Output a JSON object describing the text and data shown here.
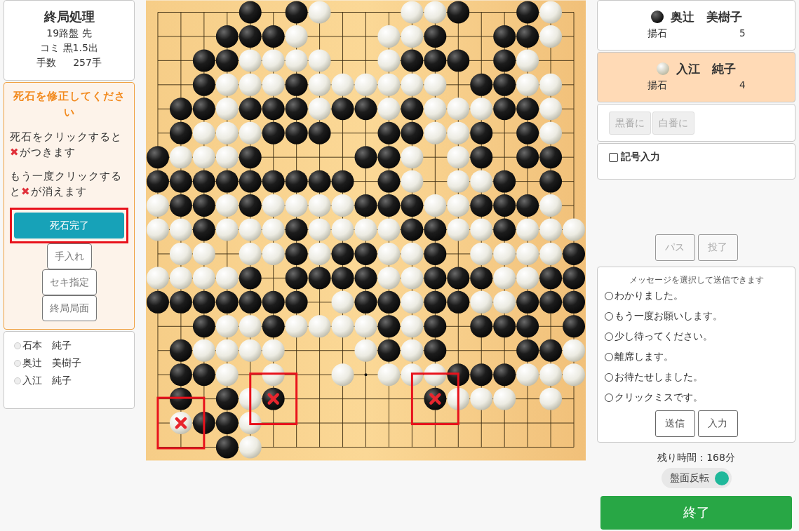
{
  "game_info": {
    "title": "終局処理",
    "lines": [
      "19路盤 先",
      "コミ 黒1.5出"
    ],
    "moves_label": "手数",
    "moves_value": "257手"
  },
  "dead_stone_panel": {
    "heading": "死石を修正してください",
    "instructions": [
      {
        "before": "死石をクリックすると",
        "mark": "✖",
        "after": "がつきます"
      },
      {
        "before": "もう一度クリックすると",
        "mark": "✖",
        "after": "が消えます"
      }
    ],
    "primary_button": {
      "label": "死石完了",
      "highlighted": true
    },
    "buttons": [
      "手入れ",
      "セキ指定",
      "終局局面"
    ]
  },
  "participants": [
    {
      "name": "石本　純子",
      "selected": false
    },
    {
      "name": "奥辻　美樹子",
      "selected": false
    },
    {
      "name": "入江　純子",
      "selected": false
    }
  ],
  "board": {
    "rows": [
      [
        {
          "kind": "empty"
        },
        {
          "kind": "empty"
        },
        {
          "kind": "empty"
        },
        {
          "kind": "empty"
        },
        {
          "kind": "black"
        },
        {
          "kind": "empty"
        },
        {
          "kind": "black"
        },
        {
          "kind": "white"
        },
        {
          "kind": "empty"
        },
        {
          "kind": "empty"
        },
        {
          "kind": "empty"
        },
        {
          "kind": "white"
        },
        {
          "kind": "white"
        },
        {
          "kind": "black"
        },
        {
          "kind": "empty"
        },
        {
          "kind": "empty"
        },
        {
          "kind": "black"
        },
        {
          "kind": "white"
        },
        {
          "kind": "empty"
        }
      ],
      [
        {
          "kind": "empty"
        },
        {
          "kind": "empty"
        },
        {
          "kind": "empty"
        },
        {
          "kind": "black"
        },
        {
          "kind": "black"
        },
        {
          "kind": "black"
        },
        {
          "kind": "white"
        },
        {
          "kind": "empty"
        },
        {
          "kind": "empty"
        },
        {
          "kind": "empty"
        },
        {
          "kind": "white"
        },
        {
          "kind": "white"
        },
        {
          "kind": "black"
        },
        {
          "kind": "empty"
        },
        {
          "kind": "empty"
        },
        {
          "kind": "black"
        },
        {
          "kind": "black"
        },
        {
          "kind": "white"
        },
        {
          "kind": "empty"
        }
      ],
      [
        {
          "kind": "empty"
        },
        {
          "kind": "empty"
        },
        {
          "kind": "black"
        },
        {
          "kind": "black"
        },
        {
          "kind": "white"
        },
        {
          "kind": "white"
        },
        {
          "kind": "white"
        },
        {
          "kind": "white"
        },
        {
          "kind": "empty"
        },
        {
          "kind": "empty"
        },
        {
          "kind": "white"
        },
        {
          "kind": "black"
        },
        {
          "kind": "black"
        },
        {
          "kind": "black"
        },
        {
          "kind": "empty"
        },
        {
          "kind": "black"
        },
        {
          "kind": "white"
        },
        {
          "kind": "empty"
        },
        {
          "kind": "empty"
        }
      ],
      [
        {
          "kind": "empty"
        },
        {
          "kind": "empty"
        },
        {
          "kind": "black"
        },
        {
          "kind": "white"
        },
        {
          "kind": "white"
        },
        {
          "kind": "white"
        },
        {
          "kind": "black"
        },
        {
          "kind": "white"
        },
        {
          "kind": "white"
        },
        {
          "kind": "white"
        },
        {
          "kind": "white"
        },
        {
          "kind": "white"
        },
        {
          "kind": "white"
        },
        {
          "kind": "empty"
        },
        {
          "kind": "black"
        },
        {
          "kind": "black"
        },
        {
          "kind": "white"
        },
        {
          "kind": "white"
        },
        {
          "kind": "empty"
        }
      ],
      [
        {
          "kind": "empty"
        },
        {
          "kind": "black"
        },
        {
          "kind": "black"
        },
        {
          "kind": "white"
        },
        {
          "kind": "black"
        },
        {
          "kind": "black"
        },
        {
          "kind": "black"
        },
        {
          "kind": "white"
        },
        {
          "kind": "black"
        },
        {
          "kind": "black"
        },
        {
          "kind": "white"
        },
        {
          "kind": "black"
        },
        {
          "kind": "white"
        },
        {
          "kind": "white"
        },
        {
          "kind": "white"
        },
        {
          "kind": "black"
        },
        {
          "kind": "black"
        },
        {
          "kind": "white"
        },
        {
          "kind": "empty"
        }
      ],
      [
        {
          "kind": "empty"
        },
        {
          "kind": "black"
        },
        {
          "kind": "white"
        },
        {
          "kind": "white"
        },
        {
          "kind": "white"
        },
        {
          "kind": "black"
        },
        {
          "kind": "black"
        },
        {
          "kind": "black"
        },
        {
          "kind": "empty"
        },
        {
          "kind": "empty"
        },
        {
          "kind": "black"
        },
        {
          "kind": "black"
        },
        {
          "kind": "white"
        },
        {
          "kind": "white"
        },
        {
          "kind": "black"
        },
        {
          "kind": "empty"
        },
        {
          "kind": "black"
        },
        {
          "kind": "white"
        },
        {
          "kind": "empty"
        }
      ],
      [
        {
          "kind": "black"
        },
        {
          "kind": "white"
        },
        {
          "kind": "white"
        },
        {
          "kind": "white"
        },
        {
          "kind": "black"
        },
        {
          "kind": "empty"
        },
        {
          "kind": "empty"
        },
        {
          "kind": "empty"
        },
        {
          "kind": "empty"
        },
        {
          "kind": "black"
        },
        {
          "kind": "black"
        },
        {
          "kind": "white"
        },
        {
          "kind": "empty"
        },
        {
          "kind": "white"
        },
        {
          "kind": "black"
        },
        {
          "kind": "empty"
        },
        {
          "kind": "black"
        },
        {
          "kind": "black"
        },
        {
          "kind": "empty"
        }
      ],
      [
        {
          "kind": "black"
        },
        {
          "kind": "black"
        },
        {
          "kind": "black"
        },
        {
          "kind": "black"
        },
        {
          "kind": "black"
        },
        {
          "kind": "black"
        },
        {
          "kind": "black"
        },
        {
          "kind": "black"
        },
        {
          "kind": "black"
        },
        {
          "kind": "empty"
        },
        {
          "kind": "black"
        },
        {
          "kind": "white"
        },
        {
          "kind": "empty"
        },
        {
          "kind": "white"
        },
        {
          "kind": "white"
        },
        {
          "kind": "black"
        },
        {
          "kind": "empty"
        },
        {
          "kind": "black"
        },
        {
          "kind": "empty"
        }
      ],
      [
        {
          "kind": "white"
        },
        {
          "kind": "black"
        },
        {
          "kind": "black"
        },
        {
          "kind": "white"
        },
        {
          "kind": "black"
        },
        {
          "kind": "white"
        },
        {
          "kind": "white"
        },
        {
          "kind": "white"
        },
        {
          "kind": "white"
        },
        {
          "kind": "black"
        },
        {
          "kind": "black"
        },
        {
          "kind": "black"
        },
        {
          "kind": "white"
        },
        {
          "kind": "white"
        },
        {
          "kind": "black"
        },
        {
          "kind": "black"
        },
        {
          "kind": "black"
        },
        {
          "kind": "white"
        },
        {
          "kind": "empty"
        }
      ],
      [
        {
          "kind": "white"
        },
        {
          "kind": "white"
        },
        {
          "kind": "black"
        },
        {
          "kind": "white"
        },
        {
          "kind": "white"
        },
        {
          "kind": "white"
        },
        {
          "kind": "black"
        },
        {
          "kind": "white"
        },
        {
          "kind": "white"
        },
        {
          "kind": "white"
        },
        {
          "kind": "white"
        },
        {
          "kind": "black"
        },
        {
          "kind": "black"
        },
        {
          "kind": "white"
        },
        {
          "kind": "white"
        },
        {
          "kind": "black"
        },
        {
          "kind": "white"
        },
        {
          "kind": "white"
        },
        {
          "kind": "white"
        }
      ],
      [
        {
          "kind": "empty"
        },
        {
          "kind": "white"
        },
        {
          "kind": "white"
        },
        {
          "kind": "empty"
        },
        {
          "kind": "white"
        },
        {
          "kind": "white"
        },
        {
          "kind": "black"
        },
        {
          "kind": "white"
        },
        {
          "kind": "black"
        },
        {
          "kind": "black"
        },
        {
          "kind": "white"
        },
        {
          "kind": "white"
        },
        {
          "kind": "black"
        },
        {
          "kind": "empty"
        },
        {
          "kind": "white"
        },
        {
          "kind": "white"
        },
        {
          "kind": "white"
        },
        {
          "kind": "white"
        },
        {
          "kind": "black"
        }
      ],
      [
        {
          "kind": "white"
        },
        {
          "kind": "white"
        },
        {
          "kind": "white"
        },
        {
          "kind": "white"
        },
        {
          "kind": "black"
        },
        {
          "kind": "empty"
        },
        {
          "kind": "black"
        },
        {
          "kind": "black"
        },
        {
          "kind": "black"
        },
        {
          "kind": "black"
        },
        {
          "kind": "white"
        },
        {
          "kind": "white"
        },
        {
          "kind": "black"
        },
        {
          "kind": "black"
        },
        {
          "kind": "black"
        },
        {
          "kind": "white"
        },
        {
          "kind": "white"
        },
        {
          "kind": "black"
        },
        {
          "kind": "black"
        }
      ],
      [
        {
          "kind": "black"
        },
        {
          "kind": "black"
        },
        {
          "kind": "black"
        },
        {
          "kind": "black"
        },
        {
          "kind": "black"
        },
        {
          "kind": "black"
        },
        {
          "kind": "black"
        },
        {
          "kind": "empty"
        },
        {
          "kind": "white"
        },
        {
          "kind": "black"
        },
        {
          "kind": "black"
        },
        {
          "kind": "white"
        },
        {
          "kind": "black"
        },
        {
          "kind": "black"
        },
        {
          "kind": "white"
        },
        {
          "kind": "white"
        },
        {
          "kind": "black"
        },
        {
          "kind": "black"
        },
        {
          "kind": "black"
        }
      ],
      [
        {
          "kind": "empty"
        },
        {
          "kind": "empty"
        },
        {
          "kind": "black"
        },
        {
          "kind": "white"
        },
        {
          "kind": "white"
        },
        {
          "kind": "black"
        },
        {
          "kind": "white"
        },
        {
          "kind": "white"
        },
        {
          "kind": "white"
        },
        {
          "kind": "white"
        },
        {
          "kind": "black"
        },
        {
          "kind": "white"
        },
        {
          "kind": "black"
        },
        {
          "kind": "empty"
        },
        {
          "kind": "black"
        },
        {
          "kind": "black"
        },
        {
          "kind": "black"
        },
        {
          "kind": "empty"
        },
        {
          "kind": "black"
        }
      ],
      [
        {
          "kind": "empty"
        },
        {
          "kind": "black"
        },
        {
          "kind": "white"
        },
        {
          "kind": "white"
        },
        {
          "kind": "white"
        },
        {
          "kind": "white"
        },
        {
          "kind": "empty"
        },
        {
          "kind": "empty"
        },
        {
          "kind": "empty"
        },
        {
          "kind": "white"
        },
        {
          "kind": "black"
        },
        {
          "kind": "white"
        },
        {
          "kind": "black"
        },
        {
          "kind": "empty"
        },
        {
          "kind": "empty"
        },
        {
          "kind": "empty"
        },
        {
          "kind": "black"
        },
        {
          "kind": "black"
        },
        {
          "kind": "white"
        }
      ],
      [
        {
          "kind": "empty"
        },
        {
          "kind": "black"
        },
        {
          "kind": "black"
        },
        {
          "kind": "white"
        },
        {
          "kind": "empty"
        },
        {
          "kind": "white"
        },
        {
          "kind": "empty"
        },
        {
          "kind": "empty"
        },
        {
          "kind": "white"
        },
        {
          "kind": "empty"
        },
        {
          "kind": "white"
        },
        {
          "kind": "white"
        },
        {
          "kind": "white"
        },
        {
          "kind": "black"
        },
        {
          "kind": "black"
        },
        {
          "kind": "black"
        },
        {
          "kind": "white"
        },
        {
          "kind": "white"
        },
        {
          "kind": "white"
        }
      ],
      [
        {
          "kind": "empty"
        },
        {
          "kind": "black"
        },
        {
          "kind": "empty"
        },
        {
          "kind": "black"
        },
        {
          "kind": "white"
        },
        {
          "kind": "deadblack"
        },
        {
          "kind": "empty"
        },
        {
          "kind": "empty"
        },
        {
          "kind": "empty"
        },
        {
          "kind": "empty"
        },
        {
          "kind": "empty"
        },
        {
          "kind": "empty"
        },
        {
          "kind": "deadblack"
        },
        {
          "kind": "white"
        },
        {
          "kind": "white"
        },
        {
          "kind": "white"
        },
        {
          "kind": "empty"
        },
        {
          "kind": "white"
        },
        {
          "kind": "empty"
        }
      ],
      [
        {
          "kind": "empty"
        },
        {
          "kind": "deadwhite"
        },
        {
          "kind": "black"
        },
        {
          "kind": "black"
        },
        {
          "kind": "white"
        },
        {
          "kind": "empty"
        },
        {
          "kind": "empty"
        },
        {
          "kind": "empty"
        },
        {
          "kind": "empty"
        },
        {
          "kind": "empty"
        },
        {
          "kind": "empty"
        },
        {
          "kind": "empty"
        },
        {
          "kind": "empty"
        },
        {
          "kind": "empty"
        },
        {
          "kind": "empty"
        },
        {
          "kind": "empty"
        },
        {
          "kind": "empty"
        },
        {
          "kind": "empty"
        },
        {
          "kind": "empty"
        }
      ],
      [
        {
          "kind": "empty"
        },
        {
          "kind": "empty"
        },
        {
          "kind": "empty"
        },
        {
          "kind": "black"
        },
        {
          "kind": "white"
        },
        {
          "kind": "empty"
        },
        {
          "kind": "empty"
        },
        {
          "kind": "empty"
        },
        {
          "kind": "empty"
        },
        {
          "kind": "empty"
        },
        {
          "kind": "empty"
        },
        {
          "kind": "empty"
        },
        {
          "kind": "empty"
        },
        {
          "kind": "empty"
        },
        {
          "kind": "empty"
        },
        {
          "kind": "empty"
        },
        {
          "kind": "empty"
        },
        {
          "kind": "empty"
        },
        {
          "kind": "empty"
        }
      ]
    ]
  },
  "players": [
    {
      "kind": "black",
      "name": "奥辻　美樹子",
      "captures_label": "揚石",
      "captures": "5",
      "active": false
    },
    {
      "kind": "white",
      "name": "入江　純子",
      "captures_label": "揚石",
      "captures": "4",
      "active": true
    }
  ],
  "turn_buttons": [
    {
      "label": "黒番に",
      "disabled": true
    },
    {
      "label": "白番に",
      "disabled": true
    }
  ],
  "symbol_input": {
    "label": "記号入力",
    "checked": false
  },
  "game_buttons": [
    {
      "label": "パス",
      "disabled": true
    },
    {
      "label": "投了",
      "disabled": true
    }
  ],
  "messages": {
    "caption": "メッセージを選択して送信できます",
    "options": [
      {
        "text": "わかりました。",
        "selected": false
      },
      {
        "text": "もう一度お願いします。",
        "selected": false
      },
      {
        "text": "少し待ってください。",
        "selected": false
      },
      {
        "text": "離席します。",
        "selected": false
      },
      {
        "text": "お待たせしました。",
        "selected": false
      },
      {
        "text": "クリックミスです。",
        "selected": false
      }
    ],
    "buttons": [
      "送信",
      "入力"
    ]
  },
  "remaining_time": "残り時間：168分",
  "flip_toggle": {
    "label": "盤面反転",
    "on": true
  },
  "end_button": "終了"
}
